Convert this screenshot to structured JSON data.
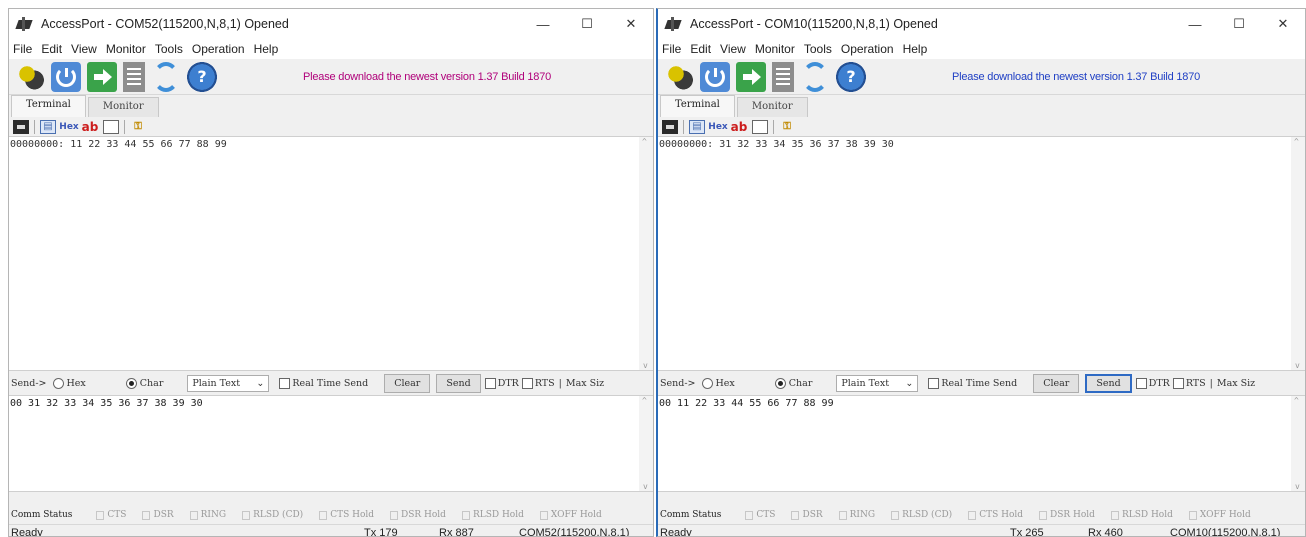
{
  "windows": [
    {
      "title": "AccessPort - COM52(115200,N,8,1) Opened",
      "notice": "Please download the newest version 1.37 Build 1870",
      "terminal_output": "00000000: 11 22 33 44 55 66 77 88 99",
      "send_text": "00 31 32 33 34 35 36 37 38 39 30",
      "status": {
        "ready": "Ready",
        "tx": "Tx 179",
        "rx": "Rx 887",
        "port": "COM52(115200,N,8,1)"
      }
    },
    {
      "title": "AccessPort - COM10(115200,N,8,1) Opened",
      "notice": "Please download the newest version 1.37 Build 1870",
      "terminal_output": "00000000: 31 32 33 34 35 36 37 38 39 30",
      "send_text": "00 11 22 33 44 55 66 77 88 99",
      "status": {
        "ready": "Ready",
        "tx": "Tx 265",
        "rx": "Rx 460",
        "port": "COM10(115200,N,8,1)"
      }
    }
  ],
  "winctl": {
    "minimize": "—",
    "maximize": "☐",
    "close": "✕"
  },
  "menu": [
    "File",
    "Edit",
    "View",
    "Monitor",
    "Tools",
    "Operation",
    "Help"
  ],
  "tabs": {
    "terminal": "Terminal",
    "monitor": "Monitor"
  },
  "subtoolbar": {
    "hex": "Hex",
    "ab": "ab"
  },
  "toolbar": {
    "help_glyph": "?"
  },
  "sendbar": {
    "send_label": "Send->",
    "hex_radio": "Hex",
    "char_radio": "Char",
    "format": "Plain Text",
    "format_arrow": "⌄",
    "realtime": "Real Time Send",
    "clear": "Clear",
    "send": "Send",
    "dtr": "DTR",
    "rts": "RTS",
    "sep": "|",
    "maxsize": "Max Siz"
  },
  "comm": {
    "label": "Comm Status",
    "leds": [
      "CTS",
      "DSR",
      "RING",
      "RLSD (CD)",
      "CTS Hold",
      "DSR Hold",
      "RLSD Hold",
      "XOFF Hold"
    ]
  },
  "colors": {
    "notice": "#b0007a",
    "focus_border": "#2e6ac4"
  },
  "icons": [
    "plug-icon",
    "power-icon",
    "arrow-right-icon",
    "document-icon",
    "refresh-icon",
    "help-icon"
  ]
}
